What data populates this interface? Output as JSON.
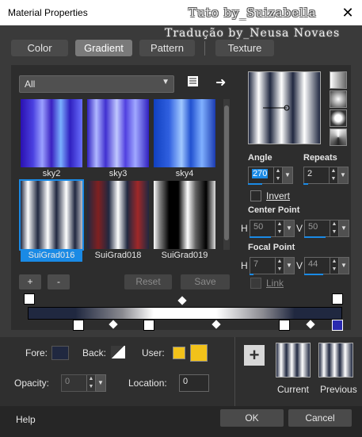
{
  "window": {
    "title": "Material Properties",
    "close_glyph": "✕"
  },
  "watermark": {
    "line1": "Tuto by_Suizabella",
    "line2": "Tradução by_Neusa Novaes"
  },
  "tabs": [
    {
      "label": "Color",
      "active": false
    },
    {
      "label": "Gradient",
      "active": true
    },
    {
      "label": "Pattern",
      "active": false
    },
    {
      "label": "Texture",
      "active": false
    }
  ],
  "filter": {
    "selected": "All"
  },
  "gradients": [
    {
      "name": "sky2"
    },
    {
      "name": "sky3"
    },
    {
      "name": "sky4"
    },
    {
      "name": "SuiGrad016",
      "selected": true
    },
    {
      "name": "SuiGrad018"
    },
    {
      "name": "SuiGrad019"
    }
  ],
  "list_buttons": {
    "add": "+",
    "remove": "-",
    "reset": "Reset",
    "save": "Save"
  },
  "angle": {
    "label": "Angle",
    "value": "270"
  },
  "repeats": {
    "label": "Repeats",
    "value": "2"
  },
  "invert": {
    "label": "Invert"
  },
  "center_point": {
    "label": "Center Point",
    "h_label": "H",
    "h_value": "50",
    "v_label": "V",
    "v_value": "50"
  },
  "focal_point": {
    "label": "Focal Point",
    "h_label": "H",
    "h_value": "7",
    "v_label": "V",
    "v_value": "44"
  },
  "link": {
    "label": "Link"
  },
  "editor": {
    "fore_label": "Fore:",
    "back_label": "Back:",
    "user_label": "User:",
    "opacity_label": "Opacity:",
    "opacity_value": "0",
    "location_label": "Location:",
    "location_value": "0",
    "user_color": "#f2c21a",
    "fore_color": "#202840"
  },
  "preview": {
    "current_label": "Current",
    "previous_label": "Previous",
    "add_glyph": "+"
  },
  "footer": {
    "help": "Help",
    "ok": "OK",
    "cancel": "Cancel"
  }
}
